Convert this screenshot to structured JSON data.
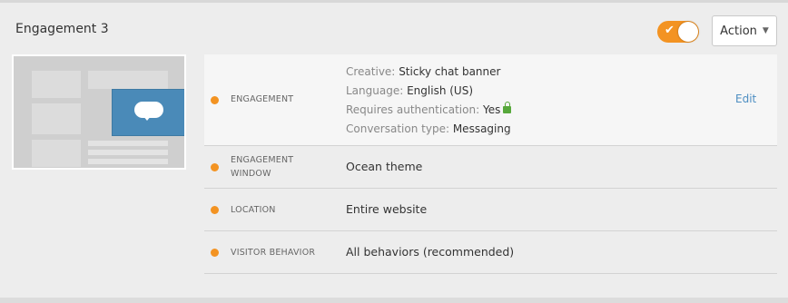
{
  "engagement": {
    "title": "Engagement 3",
    "enabled": true,
    "action_label": "Action"
  },
  "thumbnail": {
    "icon": "chat-bubble-icon"
  },
  "rows": [
    {
      "label": "ENGAGEMENT",
      "details": {
        "creative_key": "Creative:",
        "creative_val": "Sticky chat banner",
        "language_key": "Language:",
        "language_val": "English (US)",
        "auth_key": "Requires authentication:",
        "auth_val": "Yes",
        "conv_key": "Conversation type:",
        "conv_val": "Messaging"
      },
      "edit_label": "Edit"
    },
    {
      "label_line1": "ENGAGEMENT",
      "label_line2": "WINDOW",
      "value": "Ocean theme"
    },
    {
      "label": "LOCATION",
      "value": "Entire website"
    },
    {
      "label": "VISITOR BEHAVIOR",
      "value": "All behaviors (recommended)"
    }
  ],
  "colors": {
    "accent_orange": "#f39322",
    "link_blue": "#4d8ec2",
    "lock_green": "#57a83b"
  }
}
